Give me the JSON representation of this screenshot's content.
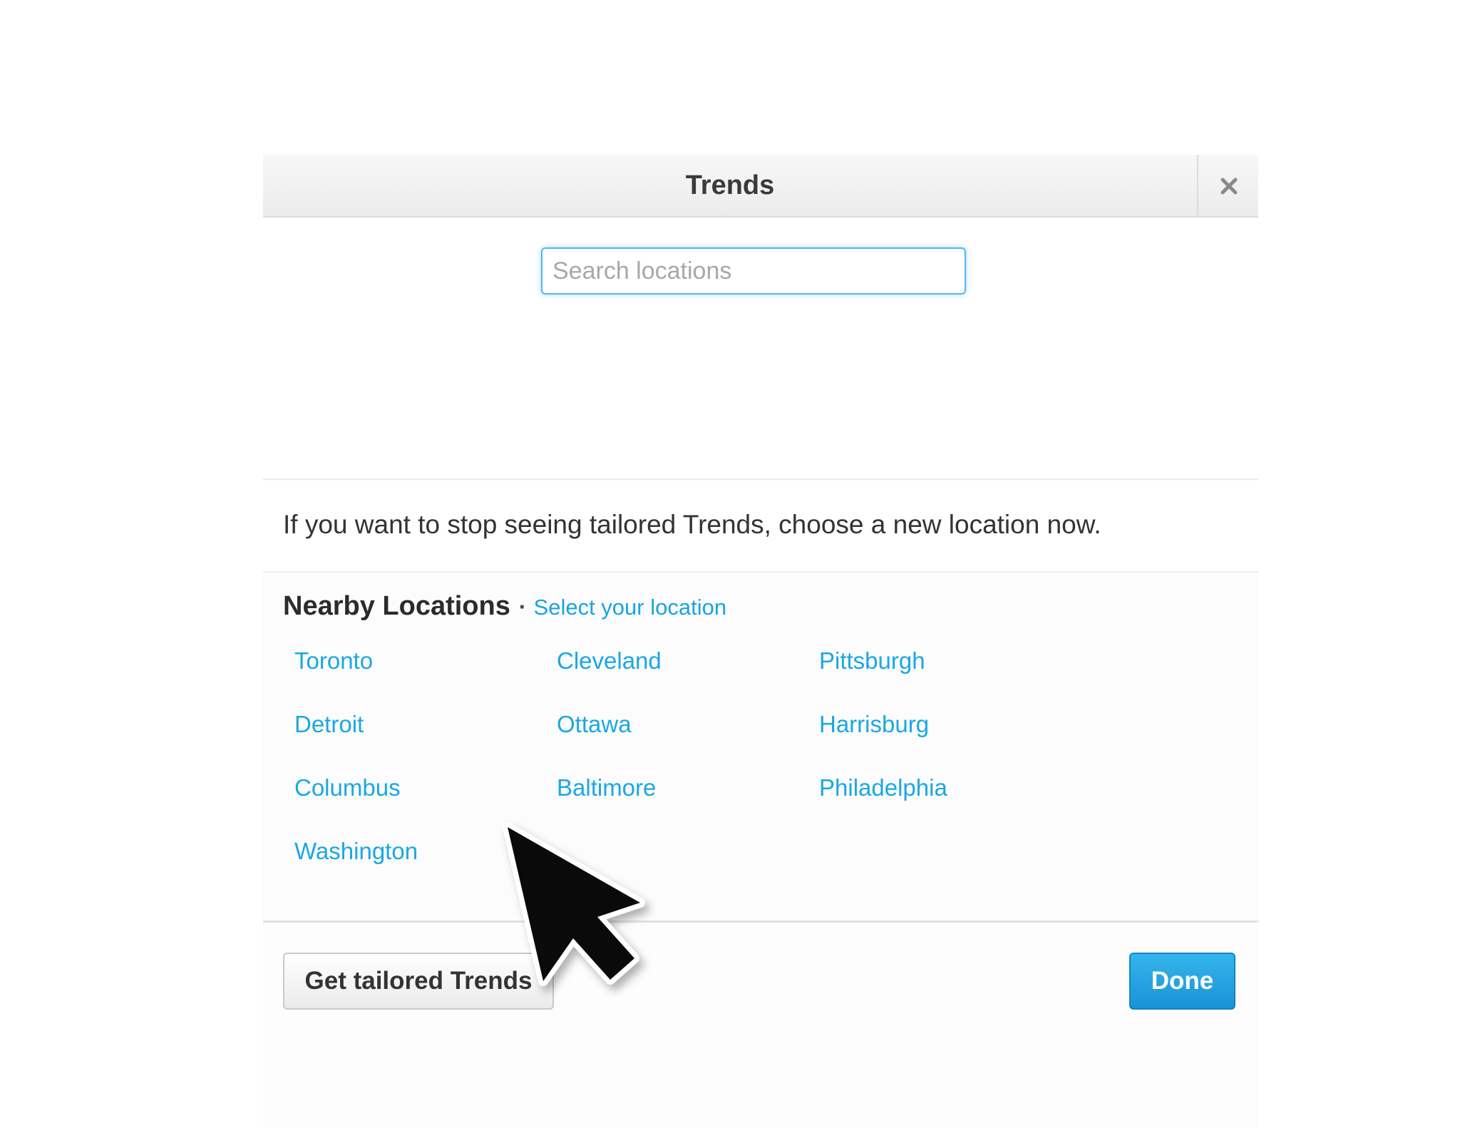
{
  "dialog": {
    "title": "Trends",
    "close_icon": "close-icon"
  },
  "search": {
    "placeholder": "Search locations",
    "value": ""
  },
  "info": {
    "text": "If you want to stop seeing tailored Trends, choose a new location now."
  },
  "nearby": {
    "heading": "Nearby Locations",
    "separator": "·",
    "select_label": "Select your location",
    "locations": [
      "Toronto",
      "Cleveland",
      "Pittsburgh",
      "Detroit",
      "Ottawa",
      "Harrisburg",
      "Columbus",
      "Baltimore",
      "Philadelphia",
      "Washington"
    ]
  },
  "footer": {
    "tailored_label": "Get tailored Trends",
    "done_label": "Done"
  },
  "colors": {
    "link": "#1ba7e3",
    "done_button": "#1a93d6",
    "search_focus": "#56b4ef"
  },
  "cursor_icon": "mouse-pointer-icon"
}
